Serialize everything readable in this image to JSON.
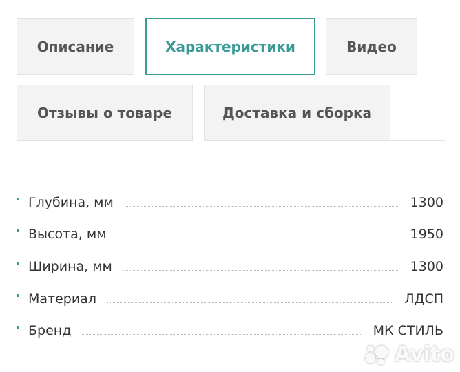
{
  "tabs": [
    {
      "label": "Описание",
      "active": false
    },
    {
      "label": "Характеристики",
      "active": true
    },
    {
      "label": "Видео",
      "active": false
    },
    {
      "label": "Отзывы о товаре",
      "active": false
    },
    {
      "label": "Доставка и сборка",
      "active": false
    }
  ],
  "specs": [
    {
      "label": "Глубина, мм",
      "value": "1300"
    },
    {
      "label": "Высота, мм",
      "value": "1950"
    },
    {
      "label": "Ширина, мм",
      "value": "1300"
    },
    {
      "label": "Материал",
      "value": "ЛДСП"
    },
    {
      "label": "Бренд",
      "value": "МК СТИЛЬ"
    }
  ],
  "watermark": {
    "text": "Avito",
    "icon": "avito-logo-icon"
  },
  "colors": {
    "accent": "#3a9a96",
    "tab_bg": "#f3f3f3",
    "tab_border": "#e2e2e2",
    "text": "#333333",
    "tab_text": "#555555"
  }
}
